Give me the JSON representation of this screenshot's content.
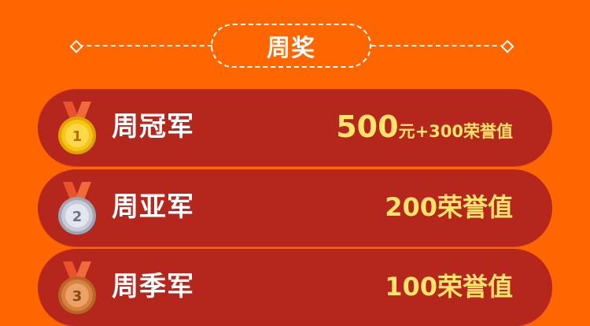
{
  "header": {
    "title": "周奖"
  },
  "rows": [
    {
      "medal_number": "1",
      "medal_type": "gold-medal",
      "name": "周冠军",
      "prize_amount": "500",
      "prize_unit": "元",
      "prize_extra": "+300荣誉值"
    },
    {
      "medal_number": "2",
      "medal_type": "silver-medal",
      "name": "周亚军",
      "prize_text": "200荣誉值"
    },
    {
      "medal_number": "3",
      "medal_type": "bronze-medal",
      "name": "周季军",
      "prize_text": "100荣誉值"
    }
  ],
  "colors": {
    "background": "#ff6600",
    "row": "#b5271d",
    "prize_text": "#ffe36a",
    "gold": "#f5c518",
    "silver": "#c9cbd6",
    "bronze": "#d9823f"
  }
}
